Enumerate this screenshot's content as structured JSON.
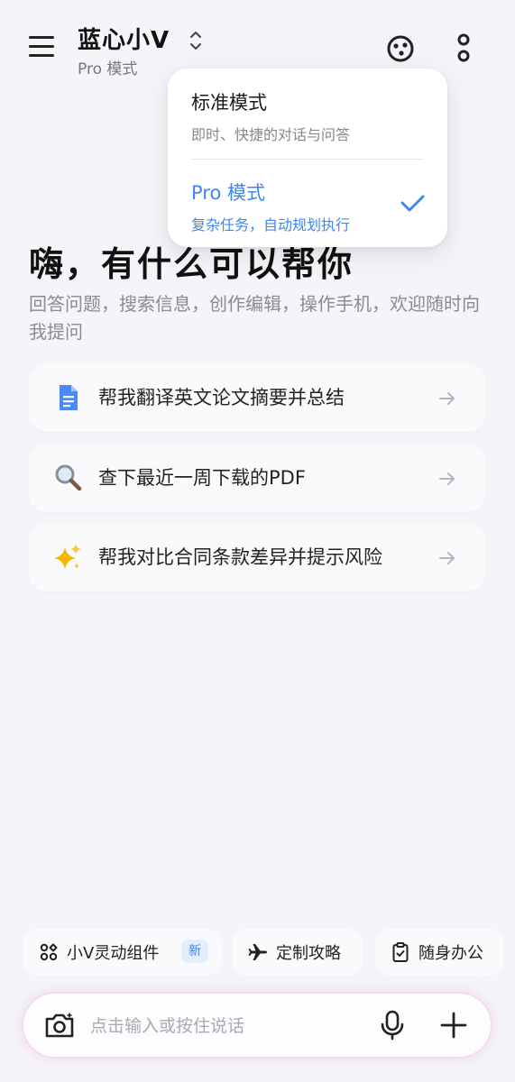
{
  "header": {
    "title": "蓝心小V",
    "subtitle": "Pro 模式",
    "icons": [
      "menu-icon",
      "chevron-updown-icon",
      "assistant-icon",
      "more-icon"
    ]
  },
  "mode_dropdown": {
    "items": [
      {
        "label": "标准模式",
        "desc": "即时、快捷的对话与问答",
        "selected": false
      },
      {
        "label": "Pro 模式",
        "desc": "复杂任务，自动规划执行",
        "selected": true
      }
    ]
  },
  "greeting": {
    "title": "嗨，有什么可以帮你",
    "desc": "回答问题，搜索信息，创作编辑，操作手机，欢迎随时向我提问"
  },
  "suggestions": [
    {
      "icon": "document-icon",
      "text": "帮我翻译英文论文摘要并总结"
    },
    {
      "icon": "magnifier-icon",
      "text": "查下最近一周下载的PDF"
    },
    {
      "icon": "sparkles-icon",
      "text": "帮我对比合同条款差异并提示风险"
    }
  ],
  "chips": [
    {
      "icon": "widgets-icon",
      "label": "小V灵动组件",
      "badge": "新"
    },
    {
      "icon": "airplane-icon",
      "label": "定制攻略"
    },
    {
      "icon": "clipboard-icon",
      "label": "随身办公"
    }
  ],
  "input": {
    "placeholder": "点击输入或按住说话"
  },
  "colors": {
    "accent": "#3f86f0",
    "background": "#f4f4f9"
  }
}
